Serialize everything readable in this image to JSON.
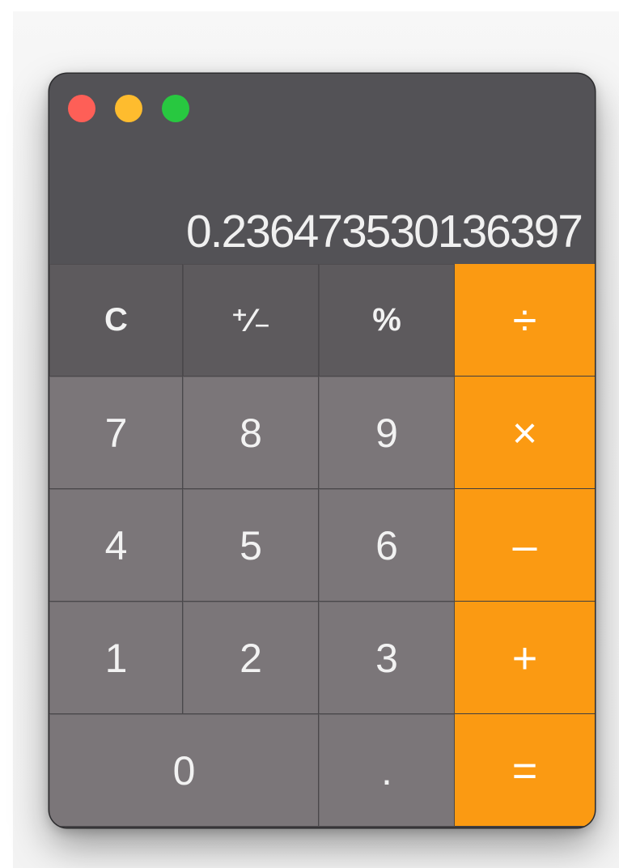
{
  "window": {
    "controls": {
      "close": {
        "icon": "close-button-red",
        "color": "#fe5f57"
      },
      "minimize": {
        "icon": "minimize-button-yellow",
        "color": "#febc2e"
      },
      "zoom": {
        "icon": "zoom-button-green",
        "color": "#28c840"
      }
    }
  },
  "display": {
    "value": "0.236473530136397"
  },
  "keys": {
    "clear": "C",
    "sign": "⁺∕₋",
    "percent": "%",
    "divide": "÷",
    "seven": "7",
    "eight": "8",
    "nine": "9",
    "multiply": "×",
    "four": "4",
    "five": "5",
    "six": "6",
    "subtract": "–",
    "one": "1",
    "two": "2",
    "three": "3",
    "add": "+",
    "zero": "0",
    "decimal": ".",
    "equals": "="
  },
  "colors": {
    "function_key": "#5d5a5d",
    "number_key": "#7b7679",
    "operator_key": "#fb9a12",
    "display_bg": "#535256"
  }
}
